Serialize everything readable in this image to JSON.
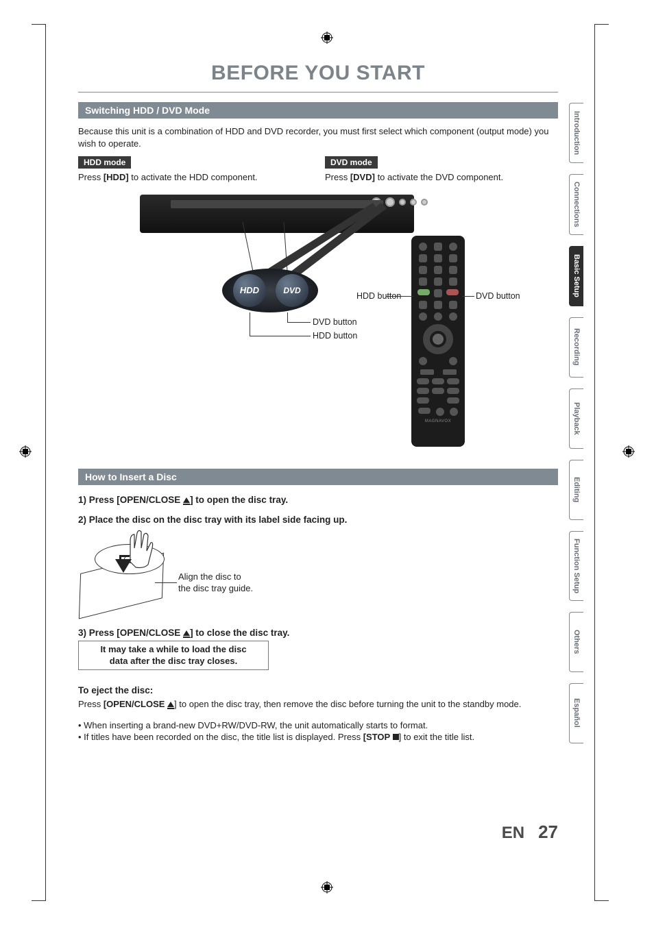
{
  "page_title": "BEFORE YOU START",
  "section1": {
    "heading": "Switching HDD / DVD Mode",
    "intro": "Because this unit is a combination of HDD and DVD recorder, you must first select which component (output mode) you wish to operate.",
    "hdd_mode_label": "HDD mode",
    "hdd_mode_text_pre": "Press ",
    "hdd_mode_btn": "[HDD]",
    "hdd_mode_text_post": " to activate the HDD component.",
    "dvd_mode_label": "DVD mode",
    "dvd_mode_text_pre": "Press ",
    "dvd_mode_btn": "[DVD]",
    "dvd_mode_text_post": " to activate the DVD component.",
    "hdd_btn_text": "HDD",
    "dvd_btn_text": "DVD",
    "label_dvd_button": "DVD button",
    "label_hdd_button": "HDD button",
    "remote_brand": "MAGNAVOX"
  },
  "section2": {
    "heading": "How to Insert a Disc",
    "step1_pre": "1) Press [OPEN/CLOSE ",
    "step1_post": "] to open the disc tray.",
    "step2": "2) Place the disc on the disc tray with its label side facing up.",
    "align_caption_l1": "Align the disc to",
    "align_caption_l2": "the disc tray guide.",
    "step3_pre": "3) Press [OPEN/CLOSE ",
    "step3_post": "] to close the disc tray.",
    "note_l1": "It may take a while to load the disc",
    "note_l2": "data after the disc tray closes.",
    "eject_heading": "To eject the disc:",
    "eject_pre": "Press ",
    "eject_btn": "[OPEN/CLOSE ",
    "eject_post": "] to open the disc tray, then remove the disc before turning the unit to the standby mode.",
    "bullet1": "• When inserting a brand-new DVD+RW/DVD-RW, the unit automatically starts to format.",
    "bullet2_pre": "• If titles have been recorded on the disc, the title list is displayed. Press ",
    "bullet2_btn": "[STOP ",
    "bullet2_post": "] to exit the title list."
  },
  "tabs": {
    "t1": "Introduction",
    "t2": "Connections",
    "t3": "Basic Setup",
    "t4": "Recording",
    "t5": "Playback",
    "t6": "Editing",
    "t7": "Function Setup",
    "t8": "Others",
    "t9": "Español"
  },
  "footer": {
    "lang": "EN",
    "page": "27"
  }
}
